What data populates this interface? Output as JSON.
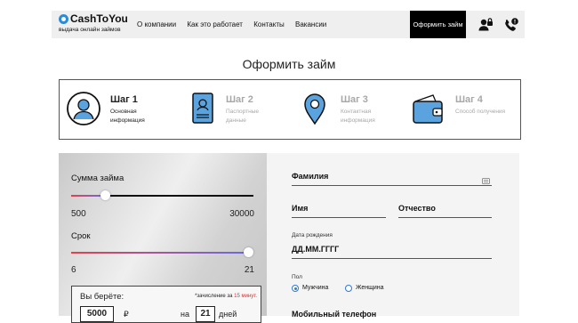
{
  "header": {
    "logo_name": "CashToYou",
    "logo_tagline": "выдача онлайн займов",
    "nav": [
      "О компании",
      "Как это работает",
      "Контакты",
      "Вакансии"
    ],
    "cta_label": "Оформить займ"
  },
  "page_title": "Оформить займ",
  "steps": [
    {
      "title": "Шаг 1",
      "line1": "Основная",
      "line2": "информация",
      "active": true
    },
    {
      "title": "Шаг 2",
      "line1": "Паспортные",
      "line2": "данные",
      "active": false
    },
    {
      "title": "Шаг 3",
      "line1": "Контактная",
      "line2": "информация",
      "active": false
    },
    {
      "title": "Шаг 4",
      "line1": "Способ получения",
      "line2": "",
      "active": false
    }
  ],
  "loan": {
    "amount_label": "Сумма займа",
    "amount_min": "500",
    "amount_max": "30000",
    "amount_fraction": 0.17,
    "term_label": "Срок",
    "term_min": "6",
    "term_max": "21",
    "term_fraction": 1.0,
    "take_label": "Вы берёте:",
    "note_prefix": "*зачисление за",
    "note_highlight": "15 минут.",
    "amount_value": "5000",
    "amount_unit": "₽",
    "term_prefix": "на",
    "term_value": "21",
    "term_unit": "дней"
  },
  "form": {
    "surname_label": "Фамилия",
    "name_label": "Имя",
    "patronymic_label": "Отчество",
    "dob_label": "Дата рождения",
    "dob_placeholder": "ДД.ММ.ГГГГ",
    "gender_label": "Пол",
    "gender_options": [
      "Мужчина",
      "Женщина"
    ],
    "gender_selected": "Мужчина",
    "phone_label": "Мобильный телефон"
  },
  "colors": {
    "accent": "#2a7ad8",
    "highlight": "#e03030",
    "cta_bg": "#000000"
  }
}
